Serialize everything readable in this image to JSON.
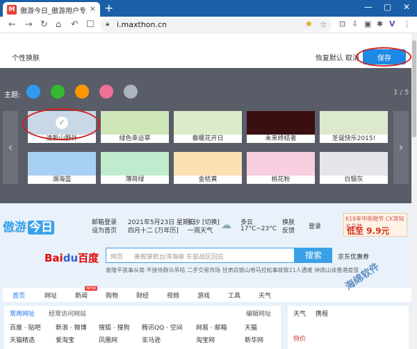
{
  "browser": {
    "tab_title": "傲游今日_傲游用户专属的网址导航",
    "tab_close": "×",
    "new_tab": "+",
    "url": "i.maxthon.cn",
    "window": {
      "min": "—",
      "max": "▢",
      "close": "✕"
    }
  },
  "skin_bar": {
    "label": "个性换肤",
    "reset": "恢复默认",
    "cancel": "取消",
    "save": "保存"
  },
  "theme_panel": {
    "themes_label": "主题:",
    "theme_colors": [
      "#2f9bf0",
      "#35b931",
      "#ff9800",
      "#ef6f96",
      "#aeb4bd"
    ],
    "pager": "1 / 5",
    "prev": "‹",
    "next": "›",
    "skins": [
      {
        "name": "清新山野外",
        "color": "#c9d8e6",
        "selected": true
      },
      {
        "name": "绿色幸运草",
        "color": "#cfe6b9"
      },
      {
        "name": "春暖花开日",
        "color": "#dcebc8"
      },
      {
        "name": "未来终结者",
        "color": "#3a0f12"
      },
      {
        "name": "圣诞快乐2015!",
        "color": "#dde9cc"
      },
      {
        "name": "湖海蓝",
        "color": "#a8d0f2"
      },
      {
        "name": "薄荷绿",
        "color": "#bfeccd"
      },
      {
        "name": "金桔黄",
        "color": "#fbe0b2"
      },
      {
        "name": "桃花粉",
        "color": "#f7cfe0"
      },
      {
        "name": "白银灰",
        "color": "#e4e6ea"
      }
    ]
  },
  "portal": {
    "logo": "傲游",
    "logo_tag": "今日",
    "mail": "邮箱登录",
    "home": "设为首页",
    "date": "2021年5月23日 星期日",
    "lunar": "四月十二 [万年历]",
    "city": "长沙 [切换]",
    "week_weather": "一周天气",
    "weather": "多云",
    "temp": "17°C~23°C",
    "skin": "换肤",
    "feedback": "反馈",
    "login": "登录",
    "ad_top": "618年中购物节 CK等知名品牌",
    "ad_price": "低至 9.9元",
    "baidu": "Bai",
    "baidu_paw": "du",
    "baidu_cn": "百度",
    "search_type": "网页",
    "search_placeholder": "美舰穿航台湾海峡 东部战区回应",
    "search_btn": "搜索",
    "jd": "京东优惠券",
    "hot": "袁隆平丧事从简 不接待群众吊唁    二手交易市场    甘肃白银山地马拉松事故致21人遇难    钟南山谈香港疫苗"
  },
  "nav_tabs": [
    "首页",
    "网址",
    "新闻",
    "购物",
    "财经",
    "视频",
    "游戏",
    "工具",
    "天气"
  ],
  "new_badge": "NEW",
  "sites": {
    "tab1": "常用网址",
    "tab2": "经常访问网站",
    "edit": "编辑网址",
    "row1": [
      "百度 · 贴吧",
      "新浪 · 微博",
      "搜狐 · 搜狗",
      "腾讯QQ · 空间",
      "网易 · 邮箱",
      "天猫"
    ],
    "row2": [
      "天猫精选",
      "爱淘宝",
      "凤凰网",
      "亚马逊",
      "淘宝网",
      "新华网"
    ]
  },
  "side": [
    "天气",
    "携程",
    "特价"
  ],
  "watermark": "海绵软件"
}
